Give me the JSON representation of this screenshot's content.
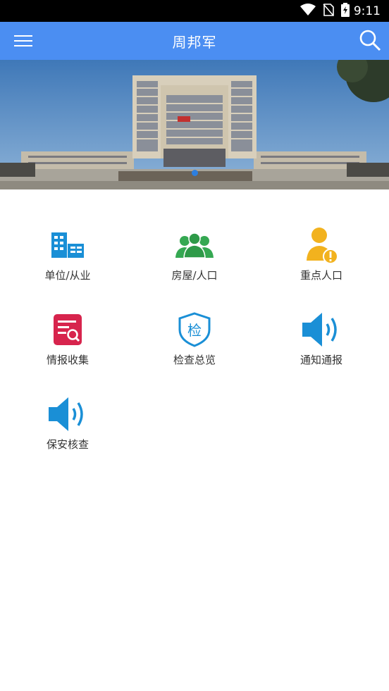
{
  "status_bar": {
    "time": "9:11"
  },
  "app_bar": {
    "title": "周邦军"
  },
  "banner": {
    "slide_count": 1,
    "active_slide": 0
  },
  "menu": [
    {
      "label": "单位/从业",
      "icon": "building-icon",
      "color": "#1a8fd6"
    },
    {
      "label": "房屋/人口",
      "icon": "people-icon",
      "color": "#35a852"
    },
    {
      "label": "重点人口",
      "icon": "alert-person-icon",
      "color": "#f2b21e"
    },
    {
      "label": "情报收集",
      "icon": "report-search-icon",
      "color": "#d7244d"
    },
    {
      "label": "检查总览",
      "icon": "inspect-shield-icon",
      "color": "#1a8fd6",
      "glyph": "检"
    },
    {
      "label": "通知通报",
      "icon": "speaker-icon",
      "color": "#1a8fd6"
    },
    {
      "label": "保安核查",
      "icon": "speaker-icon",
      "color": "#1a8fd6"
    }
  ]
}
